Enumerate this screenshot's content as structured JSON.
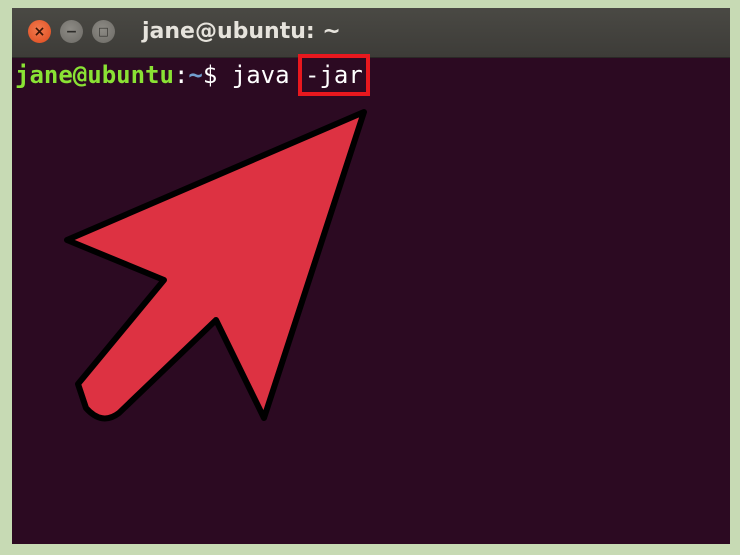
{
  "window": {
    "title": "jane@ubuntu: ~",
    "controls": {
      "close_glyph": "×",
      "minimize_glyph": "−",
      "maximize_glyph": "□"
    }
  },
  "terminal": {
    "prompt_user": "jane@ubuntu",
    "prompt_colon": ":",
    "prompt_path": "~",
    "prompt_symbol": "$",
    "command": " java ",
    "highlighted_arg": "-jar"
  },
  "colors": {
    "background": "#2c0a22",
    "user_color": "#8ae234",
    "path_color": "#729fcf",
    "highlight_box": "#e8181e",
    "arrow_fill": "#dd3242",
    "page_frame": "#c7dab4"
  },
  "annotations": {
    "arrow_icon": "pointer-arrow-icon",
    "highlight_box_icon": "highlight-box"
  }
}
